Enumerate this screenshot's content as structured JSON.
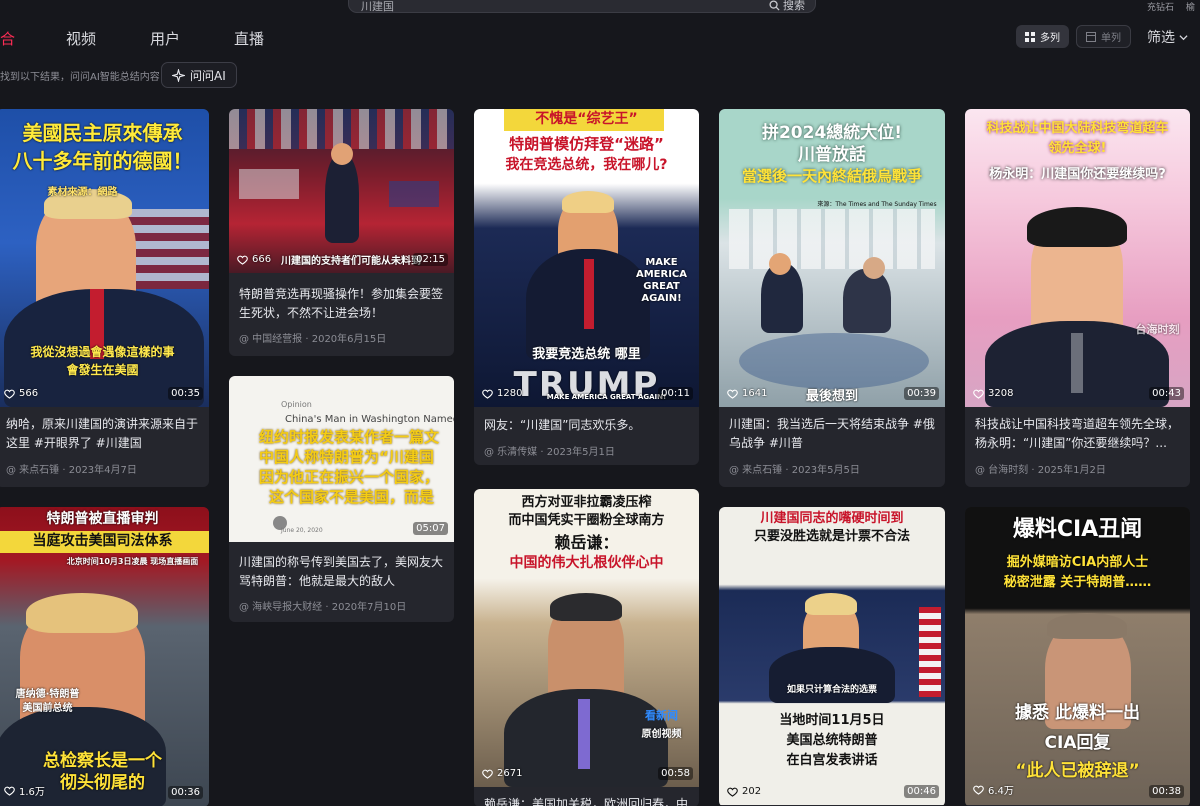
{
  "header": {
    "search_value": "川建国",
    "search_button": "搜索",
    "corner_left": "充钻石",
    "corner_right": "榆",
    "tabs": [
      "合",
      "视频",
      "用户",
      "直播"
    ],
    "hint": "找到以下结果，问问AI智能总结内容",
    "ask_ai": "问问AI",
    "view_multi": "多列",
    "view_single": "单列",
    "filter": "筛选"
  },
  "colors": {
    "accent": "#fe2c55",
    "card_bg": "#25262d",
    "page_bg": "#16171c"
  },
  "cards": [
    {
      "captions": [
        "美國民主原來傳承",
        "八十多年前的德國！",
        "素材來源：網路",
        "我從沒想過會遇像這樣的事",
        "會發生在美國"
      ],
      "likes": "566",
      "duration": "00:35",
      "title": "纳哈，原来川建国的演讲来源来自于这里 #开眼界了 #川建国",
      "meta": "@ 来点石锤 · 2023年4月7日"
    },
    {
      "captions": [
        "川建国的支持者们可能从未料到"
      ],
      "likes": "666",
      "duration": "02:15",
      "title": "特朗普竞选再现骚操作！参加集会要签生死状，不然不让进会场！",
      "meta": "@ 中国经营报 · 2020年6月15日"
    },
    {
      "captions": [
        "Opinion",
        "China's Man in Washington Named...",
        "纽约时报发表某作者一篇文",
        "中国人称特朗普为“川建国",
        "因为他正在振兴一个国家，",
        "这个国家不是美国，而是",
        "June 20, 2020"
      ],
      "likes": "",
      "duration": "05:07",
      "title": "川建国的称号传到美国去了，美网友大骂特朗普：他就是最大的敌人",
      "meta": "@ 海峡导报大财经 · 2020年7月10日"
    },
    {
      "captions": [
        "不愧是“综艺王”",
        "特朗普模仿拜登“迷路”",
        "我在竞选总统，我在哪儿?",
        "TRUMP",
        "我要竞选总统 哪里",
        "MAKE AMERICA GREAT AGAIN!",
        "MAKE AMERICA GREAT AGAIN!"
      ],
      "likes": "1280",
      "duration": "00:11",
      "title": "网友：“川建国”同志欢乐多。",
      "meta": "@ 乐清传媒 · 2023年5月1日"
    },
    {
      "captions": [
        "西方对亚非拉霸凌压榨",
        "而中国凭实干圈粉全球南方",
        "赖岳谦：",
        "中国的伟大扎根伙伴心中",
        "看新闻",
        "原创视频"
      ],
      "likes": "2671",
      "duration": "00:58",
      "title": "赖岳谦：美国加关税，欧洲回归春，中",
      "meta": ""
    },
    {
      "captions": [
        "拼2024總統大位!",
        "川普放話",
        "當選後一天內終結俄烏戰爭",
        "來源：The Times and The Sunday Times",
        "最後想到"
      ],
      "likes": "1641",
      "duration": "00:39",
      "title": "川建国：我当选后一天将结束战争 #俄乌战争 #川普",
      "meta": "@ 来点石锤 · 2023年5月5日"
    },
    {
      "captions": [
        "川建国同志的嘴硬时间到",
        "只要没胜选就是计票不合法",
        "如果只计算合法的选票",
        "当地时间11月5日",
        "美国总统特朗普",
        "在白宫发表讲话"
      ],
      "likes": "202",
      "duration": "00:46",
      "title": "",
      "meta": ""
    },
    {
      "captions": [
        "科技战让中国大陆科技弯道超车",
        "领先全球!",
        "杨永明：川建国你还要继续吗?",
        "台海时刻"
      ],
      "likes": "3208",
      "duration": "00:43",
      "title": "科技战让中国科技弯道超车领先全球，杨永明：“川建国”你还要继续吗？...",
      "meta": "@ 台海时刻 · 2025年1月2日"
    },
    {
      "captions": [
        "爆料CIA丑闻",
        "掘外媒暗访CIA内部人士",
        "秘密泄露 关于特朗普……",
        "據悉 此爆料一出",
        "CIA回复",
        "“此人已被辞退”"
      ],
      "likes": "6.4万",
      "duration": "00:38",
      "title": "",
      "meta": ""
    },
    {
      "captions": [
        "特朗普被直播审判",
        "当庭攻击美国司法体系",
        "北京时间10月3日凌晨 现场直播画面",
        "唐纳德·特朗普",
        "美国前总统",
        "总检察长是一个",
        "彻头彻尾的"
      ],
      "likes": "1.6万",
      "duration": "00:36",
      "title": "",
      "meta": ""
    }
  ]
}
